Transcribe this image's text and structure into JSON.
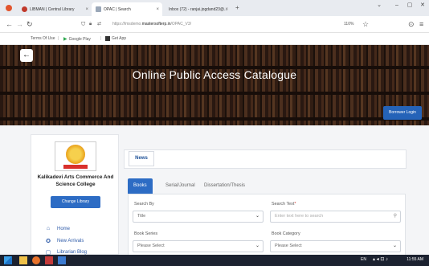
{
  "browser": {
    "tabs": [
      {
        "label": "LIBMAN | Central Library"
      },
      {
        "label": "OPAC | Search"
      },
      {
        "label": "Inbox (72) - ranjai.jogdand23@..."
      }
    ],
    "new_tab": "+",
    "url_prefix": "https://lmsdemo.",
    "url_domain": "mastersofterp.in",
    "url_path": "/OPAC_V3/",
    "zoom": "110%"
  },
  "bookmarks": {
    "terms": "Terms Of Use",
    "google_play": "Google Play",
    "get_app": "Get App"
  },
  "hero": {
    "title": "Online Public Access Catalogue",
    "borrower_login": "Borrower Login"
  },
  "sidebar": {
    "college_name": "Kalikadevi Arts Commerce And Science College",
    "change_library": "Change Library",
    "items": [
      {
        "label": "Home"
      },
      {
        "label": "New Arrivals"
      },
      {
        "label": "Librarian Blog"
      }
    ]
  },
  "main": {
    "news_label": "News",
    "tabs": [
      {
        "label": "Books"
      },
      {
        "label": "Serial/Journal"
      },
      {
        "label": "Dissertation/Thesis"
      }
    ],
    "search_by_label": "Search By",
    "search_by_value": "Title",
    "search_text_label": "Search Text",
    "required_mark": "*",
    "search_placeholder": "Enter text here to search",
    "book_series_label": "Book Series",
    "book_series_value": "Please Select",
    "book_category_label": "Book Category",
    "book_category_value": "Please Select"
  },
  "taskbar": {
    "time": "11:55 AM",
    "lang": "EN"
  },
  "colors": {
    "primary": "#2d6cc4",
    "borrower_button": "#2563b8",
    "link": "#2d5aa8"
  }
}
